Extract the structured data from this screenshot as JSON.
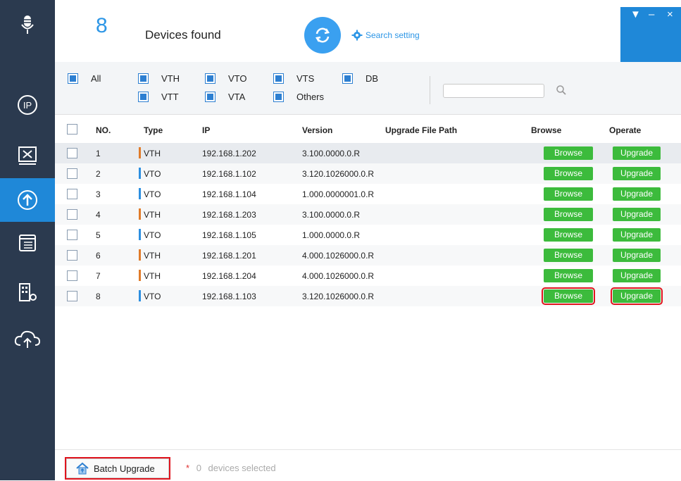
{
  "header": {
    "count": "8",
    "found_label": "Devices found",
    "search_setting_label": "Search setting"
  },
  "filters": {
    "items": [
      {
        "label": "All"
      },
      {
        "label": "VTH"
      },
      {
        "label": "VTO"
      },
      {
        "label": "VTS"
      },
      {
        "label": "DB"
      },
      {
        "label": "VTT"
      },
      {
        "label": "VTA"
      },
      {
        "label": "Others"
      }
    ],
    "search_value": ""
  },
  "table": {
    "columns": [
      "NO.",
      "Type",
      "IP",
      "Version",
      "Upgrade File Path",
      "Browse",
      "Operate"
    ],
    "browse_label": "Browse",
    "upgrade_label": "Upgrade",
    "type_colors": {
      "VTH": "#e07b2a",
      "VTO": "#2d8fe0"
    },
    "rows": [
      {
        "no": "1",
        "type": "VTH",
        "ip": "192.168.1.202",
        "version": "3.100.0000.0.R",
        "path": ""
      },
      {
        "no": "2",
        "type": "VTO",
        "ip": "192.168.1.102",
        "version": "3.120.1026000.0.R",
        "path": ""
      },
      {
        "no": "3",
        "type": "VTO",
        "ip": "192.168.1.104",
        "version": "1.000.0000001.0.R",
        "path": ""
      },
      {
        "no": "4",
        "type": "VTH",
        "ip": "192.168.1.203",
        "version": "3.100.0000.0.R",
        "path": ""
      },
      {
        "no": "5",
        "type": "VTO",
        "ip": "192.168.1.105",
        "version": "1.000.0000.0.R",
        "path": ""
      },
      {
        "no": "6",
        "type": "VTH",
        "ip": "192.168.1.201",
        "version": "4.000.1026000.0.R",
        "path": ""
      },
      {
        "no": "7",
        "type": "VTH",
        "ip": "192.168.1.204",
        "version": "4.000.1026000.0.R",
        "path": ""
      },
      {
        "no": "8",
        "type": "VTO",
        "ip": "192.168.1.103",
        "version": "3.120.1026000.0.R",
        "path": ""
      }
    ]
  },
  "footer": {
    "batch_label": "Batch Upgrade",
    "star": "*",
    "selected_count": "0",
    "selected_label": "devices selected"
  },
  "colors": {
    "sidebar": "#2b3a4f",
    "accent": "#1f88d8",
    "button_green": "#3cbb3c",
    "highlight_red": "#e0141e"
  },
  "sidebar": {
    "items": [
      {
        "icon": "microphone-icon"
      },
      {
        "icon": "ip-config-icon"
      },
      {
        "icon": "system-settings-icon"
      },
      {
        "icon": "upgrade-icon",
        "active": true
      },
      {
        "icon": "document-icon"
      },
      {
        "icon": "building-settings-icon"
      },
      {
        "icon": "cloud-upload-icon"
      }
    ]
  }
}
